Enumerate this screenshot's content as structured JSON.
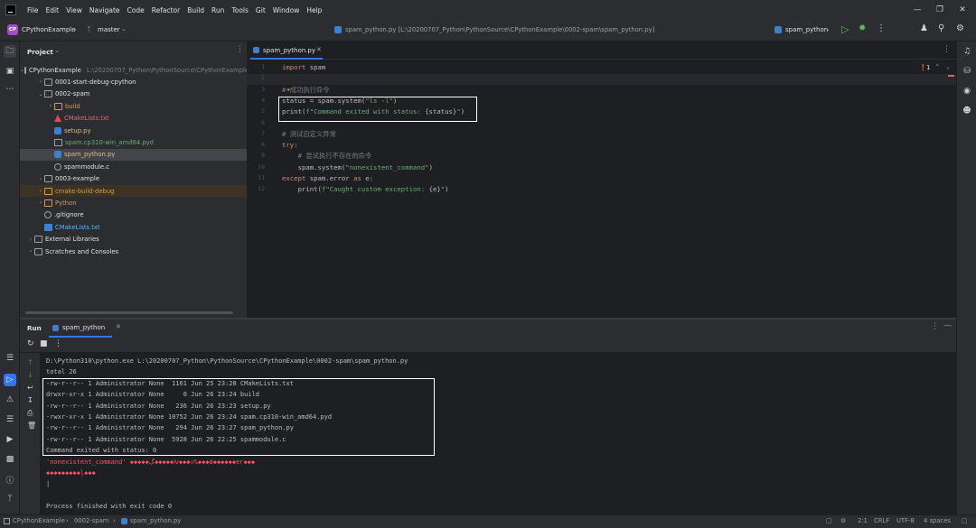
{
  "menu": {
    "items": [
      {
        "label": "File"
      },
      {
        "label": "Edit"
      },
      {
        "label": "View"
      },
      {
        "label": "Navigate"
      },
      {
        "label": "Code"
      },
      {
        "label": "Refactor"
      },
      {
        "label": "Build"
      },
      {
        "label": "Run"
      },
      {
        "label": "Tools"
      },
      {
        "label": "Git"
      },
      {
        "label": "Window"
      },
      {
        "label": "Help"
      }
    ]
  },
  "toolbar": {
    "project_badge": "CP",
    "project_name": "CPythonExample",
    "branch": "master",
    "file_title": "spam_python.py [L:\\20200707_Python\\PythonSource\\CPythonExample\\0002-spam\\spam_python.py]",
    "run_config": "spam_python"
  },
  "project": {
    "title": "Project",
    "tree": [
      {
        "label": "CPythonExample",
        "extra": "L:\\20200707_Python\\PythonSource\\CPythonExample",
        "indent": 0,
        "kind": "folder",
        "arrow": "down"
      },
      {
        "label": "0001-start-debug-cpython",
        "indent": 1,
        "kind": "folder",
        "arrow": "right"
      },
      {
        "label": "0002-spam",
        "indent": 1,
        "kind": "folder",
        "arrow": "down"
      },
      {
        "label": "build",
        "indent": 2,
        "kind": "folder-o",
        "arrow": "right",
        "color": "#d39b5a"
      },
      {
        "label": "CMakeLists.txt",
        "indent": 2,
        "kind": "cm",
        "arrow": "",
        "color": "#e06c75"
      },
      {
        "label": "setup.py",
        "indent": 2,
        "kind": "py",
        "arrow": "",
        "color": "#e0c070"
      },
      {
        "label": "spam.cp310-win_amd64.pyd",
        "indent": 2,
        "kind": "pyd",
        "arrow": "",
        "color": "#6aab73"
      },
      {
        "label": "spam_python.py",
        "indent": 2,
        "kind": "py",
        "arrow": "",
        "color": "#e0c070",
        "selected": true
      },
      {
        "label": "spammodule.c",
        "indent": 2,
        "kind": "c",
        "arrow": "",
        "color": "#dfe1e5"
      },
      {
        "label": "0003-example",
        "indent": 1,
        "kind": "folder",
        "arrow": "right"
      },
      {
        "label": "cmake-build-debug",
        "indent": 1,
        "kind": "folder-o",
        "arrow": "right",
        "color": "#d39b5a",
        "excluded": true
      },
      {
        "label": "Python",
        "indent": 1,
        "kind": "folder-o",
        "arrow": "right",
        "color": "#d39b5a"
      },
      {
        "label": ".gitignore",
        "indent": 1,
        "kind": "git",
        "arrow": "",
        "color": "#dfe1e5"
      },
      {
        "label": "CMakeLists.txt",
        "indent": 1,
        "kind": "txt",
        "arrow": "",
        "color": "#5fb8f5"
      },
      {
        "label": "External Libraries",
        "indent": 0,
        "kind": "lib",
        "arrow": "right"
      },
      {
        "label": "Scratches and Consoles",
        "indent": 0,
        "kind": "lib",
        "arrow": "right"
      }
    ]
  },
  "editor": {
    "tab_label": "spam_python.py",
    "error_count": "1",
    "lines": [
      {
        "n": "1",
        "html": "<span class=\"kw\">import</span> spam"
      },
      {
        "n": "2",
        "html": ""
      },
      {
        "n": "3",
        "html": "<span class=\"cmt\"># 成功执行命令</span>"
      },
      {
        "n": "4",
        "html": "status = spam.system(<span class=\"str\">\"ls -l\"</span>)"
      },
      {
        "n": "5",
        "html": "print(<span class=\"str\">f\"Command exited with status: </span>{status}<span class=\"str\">\"</span>)"
      },
      {
        "n": "6",
        "html": ""
      },
      {
        "n": "7",
        "html": "<span class=\"cmt\"># 测试自定义异常</span>"
      },
      {
        "n": "8",
        "html": "<span class=\"kw\">try</span>:"
      },
      {
        "n": "9",
        "html": "    <span class=\"cmt\"># 尝试执行不存在的命令</span>"
      },
      {
        "n": "10",
        "html": "    spam.system(<span class=\"str\">\"nonexistent_command\"</span>)"
      },
      {
        "n": "11",
        "html": "<span class=\"kw\">except</span> spam.error <span class=\"kw\">as</span> e:"
      },
      {
        "n": "12",
        "html": "    print(<span class=\"str\">f\"Caught custom exception: </span>{e}<span class=\"str\">\"</span>)"
      }
    ]
  },
  "run": {
    "title": "Run",
    "tab_label": "spam_python",
    "lines": [
      {
        "text": "D:\\Python310\\python.exe L:\\20200707_Python\\PythonSource\\CPythonExample\\0002-spam\\spam_python.py",
        "err": false
      },
      {
        "text": "total 26",
        "err": false
      },
      {
        "text": "-rw-r--r-- 1 Administrator None  1161 Jun 25 23:28 CMakeLists.txt",
        "err": false
      },
      {
        "text": "drwxr-xr-x 1 Administrator None     0 Jun 26 23:24 build",
        "err": false
      },
      {
        "text": "-rw-r--r-- 1 Administrator None   236 Jun 26 23:23 setup.py",
        "err": false
      },
      {
        "text": "-rwxr-xr-x 1 Administrator None 10752 Jun 26 23:24 spam.cp310-win_amd64.pyd",
        "err": false
      },
      {
        "text": "-rw-r--r-- 1 Administrator None   294 Jun 26 23:27 spam_python.py",
        "err": false
      },
      {
        "text": "-rw-r--r-- 1 Administrator None  5928 Jun 26 22:25 spammodule.c",
        "err": false
      },
      {
        "text": "Command exited with status: 0",
        "err": false
      },
      {
        "text": "'nonexistent_command' ◆◆◆◆◆ڲ◆◆◆◆◆ⅳ◆◆◆◇%◆◆◆ǿ◆◆◆◆◆◆ег◆◆◆",
        "err": true
      },
      {
        "text": "◆◆◆◆◆◆◆◆◆ļ◆◆◆",
        "err": true
      },
      {
        "text": "|",
        "err": false
      },
      {
        "text": "",
        "err": false
      },
      {
        "text": "Process finished with exit code 0",
        "err": false
      }
    ]
  },
  "status": {
    "crumb_project": "CPythonExample",
    "crumb_folder": "0002-spam",
    "crumb_file": "spam_python.py",
    "position": "2:1",
    "line_sep": "CRLF",
    "encoding": "UTF-8",
    "indent": "4 spaces"
  }
}
